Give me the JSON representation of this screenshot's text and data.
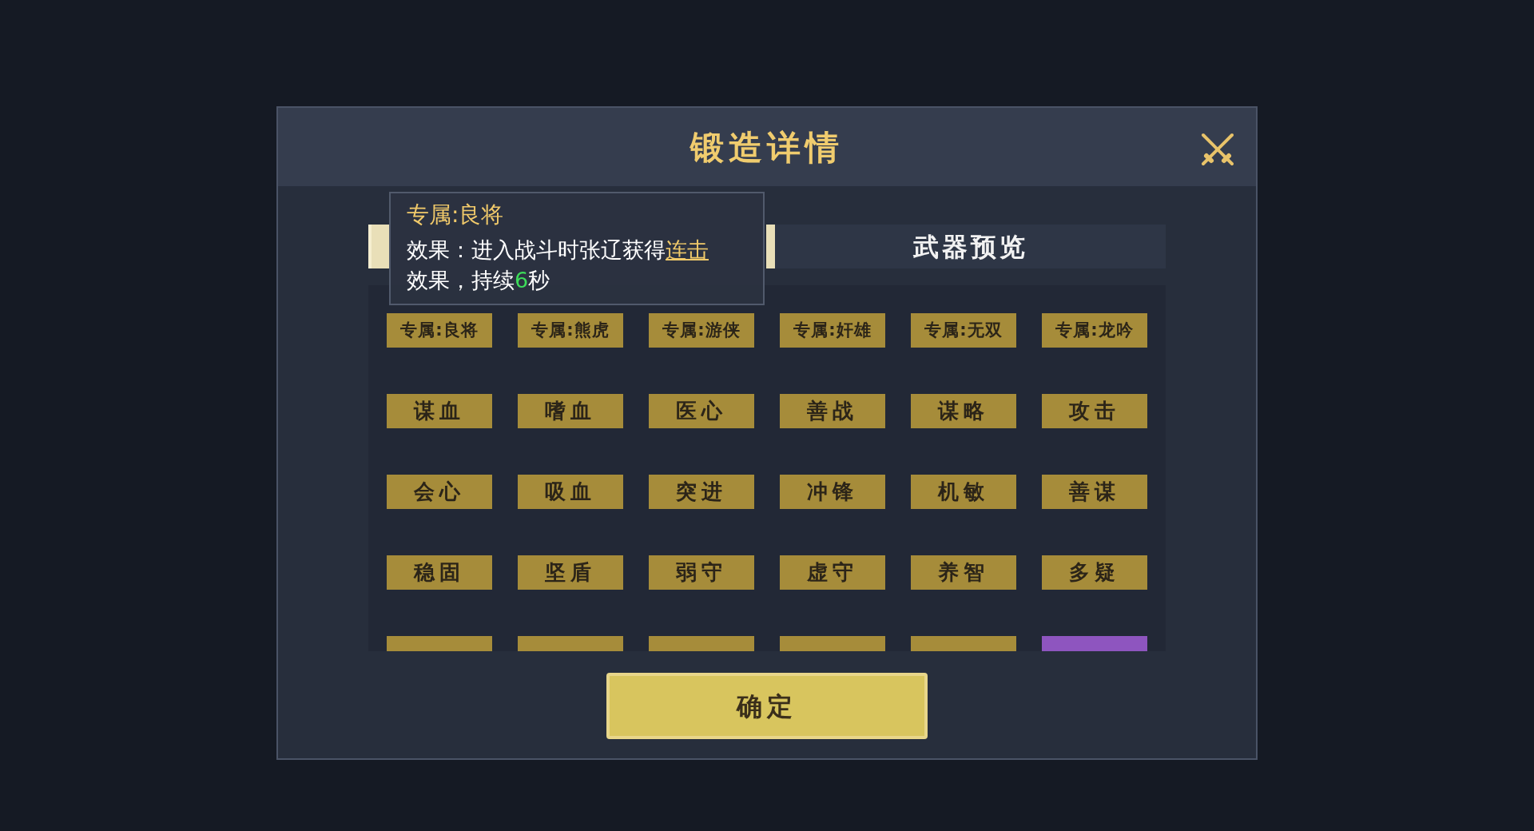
{
  "dialog": {
    "title": "锻造详情"
  },
  "tabs": [
    {
      "selected": true
    },
    {
      "label": "武器预览",
      "selected": false
    }
  ],
  "tooltip": {
    "title": "专属:良将",
    "description": [
      {
        "text": "效果：进入战斗时张辽获得"
      },
      {
        "text": "连击",
        "kind": "link"
      },
      {
        "text": "效果，持续"
      },
      {
        "text": "6",
        "kind": "number"
      },
      {
        "text": "秒"
      }
    ]
  },
  "tiles": [
    {
      "label": "专属:良将",
      "color": "#a68c3a"
    },
    {
      "label": "专属:熊虎",
      "color": "#a68c3a"
    },
    {
      "label": "专属:游侠",
      "color": "#a68c3a"
    },
    {
      "label": "专属:奸雄",
      "color": "#a68c3a"
    },
    {
      "label": "专属:无双",
      "color": "#a68c3a"
    },
    {
      "label": "专属:龙吟",
      "color": "#a68c3a"
    },
    {
      "label": "谋血",
      "color": "#a68c3a"
    },
    {
      "label": "嗜血",
      "color": "#a68c3a"
    },
    {
      "label": "医心",
      "color": "#a68c3a"
    },
    {
      "label": "善战",
      "color": "#a68c3a"
    },
    {
      "label": "谋略",
      "color": "#a68c3a"
    },
    {
      "label": "攻击",
      "color": "#a68c3a"
    },
    {
      "label": "会心",
      "color": "#a68c3a"
    },
    {
      "label": "吸血",
      "color": "#a68c3a"
    },
    {
      "label": "突进",
      "color": "#a68c3a"
    },
    {
      "label": "冲锋",
      "color": "#a68c3a"
    },
    {
      "label": "机敏",
      "color": "#a68c3a"
    },
    {
      "label": "善谋",
      "color": "#a68c3a"
    },
    {
      "label": "稳固",
      "color": "#a68c3a"
    },
    {
      "label": "坚盾",
      "color": "#a68c3a"
    },
    {
      "label": "弱守",
      "color": "#a68c3a"
    },
    {
      "label": "虚守",
      "color": "#a68c3a"
    },
    {
      "label": "养智",
      "color": "#a68c3a"
    },
    {
      "label": "多疑",
      "color": "#a68c3a"
    },
    {
      "color": "#a68c3a"
    },
    {
      "color": "#a68c3a"
    },
    {
      "color": "#a68c3a"
    },
    {
      "color": "#a68c3a"
    },
    {
      "color": "#a68c3a"
    },
    {
      "color": "#8e55bf"
    }
  ],
  "confirm_button": {
    "label": "确定"
  }
}
